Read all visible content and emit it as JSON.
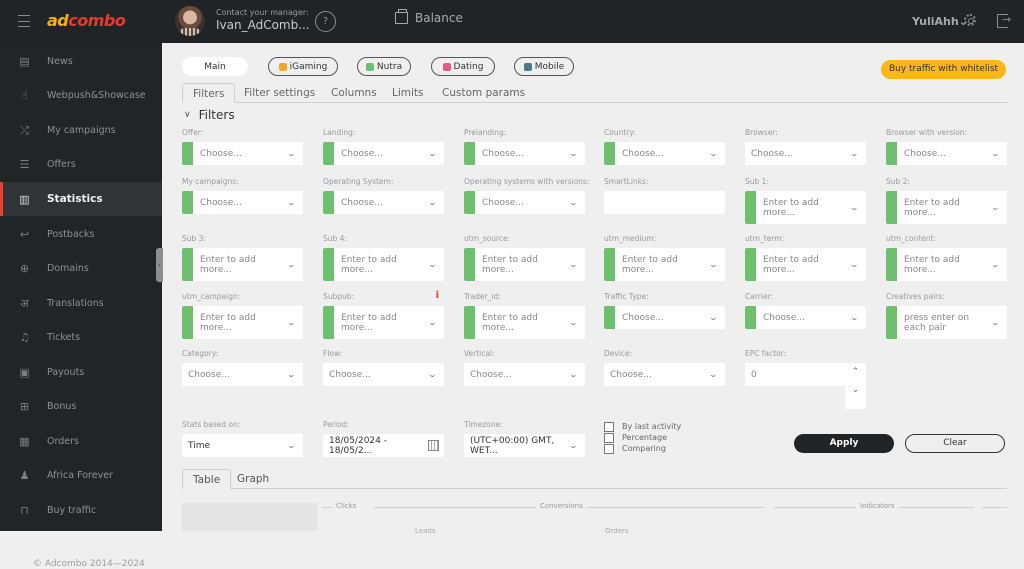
{
  "header": {
    "logo_prefix": "ad",
    "logo_suffix": "combo",
    "manager_label": "Contact your manager:",
    "manager_name": "Ivan_AdComb...",
    "help_glyph": "?",
    "balance_label": "Balance",
    "username": "YuliAhh",
    "username_chevron": "⌄"
  },
  "sidebar": {
    "items": [
      {
        "label": "News",
        "icon": "newspaper-icon",
        "glyph": "▤"
      },
      {
        "label": "Webpush&Showcase",
        "icon": "hand-bell-icon",
        "glyph": "☝"
      },
      {
        "label": "My campaigns",
        "icon": "shuffle-icon",
        "glyph": "⤮"
      },
      {
        "label": "Offers",
        "icon": "document-list-icon",
        "glyph": "☰"
      },
      {
        "label": "Statistics",
        "icon": "bar-chart-icon",
        "glyph": "▥",
        "active": true
      },
      {
        "label": "Postbacks",
        "icon": "return-arrow-icon",
        "glyph": "↩"
      },
      {
        "label": "Domains",
        "icon": "globe-icon",
        "glyph": "⊕"
      },
      {
        "label": "Translations",
        "icon": "translate-icon",
        "glyph": "अ"
      },
      {
        "label": "Tickets",
        "icon": "bell-icon",
        "glyph": "♫"
      },
      {
        "label": "Payouts",
        "icon": "wallet-icon",
        "glyph": "▣"
      },
      {
        "label": "Bonus",
        "icon": "gift-icon",
        "glyph": "⊞"
      },
      {
        "label": "Orders",
        "icon": "calendar-icon",
        "glyph": "▦"
      },
      {
        "label": "Africa Forever",
        "icon": "users-icon",
        "glyph": "♟"
      },
      {
        "label": "Buy traffic",
        "icon": "bag-icon",
        "glyph": "⊓"
      }
    ],
    "copyright": "© Adcombo 2014—2024",
    "collapse_glyph": "‹"
  },
  "verticals": [
    {
      "label": "Main",
      "selected": true
    },
    {
      "label": "iGaming",
      "icon": "slot-icon",
      "color": "#f5a623"
    },
    {
      "label": "Nutra",
      "icon": "leaf-icon",
      "color": "#6ec06f"
    },
    {
      "label": "Dating",
      "icon": "hearts-icon",
      "color": "#e35d8a"
    },
    {
      "label": "Mobile",
      "icon": "phone-icon",
      "color": "#4c7a8a"
    }
  ],
  "buy_whitelist_label": "Buy traffic with whitelist",
  "tabs": [
    {
      "label": "Filters",
      "selected": true
    },
    {
      "label": "Filter settings"
    },
    {
      "label": "Columns"
    },
    {
      "label": "Limits"
    },
    {
      "label": "Custom params"
    }
  ],
  "filters_title": "Filters",
  "filters": [
    {
      "label": "Offer:",
      "value": "Choose..."
    },
    {
      "label": "Landing:",
      "value": "Choose..."
    },
    {
      "label": "Prelanding:",
      "value": "Choose..."
    },
    {
      "label": "Country:",
      "value": "Choose..."
    },
    {
      "label": "Browser:",
      "value": "Choose..."
    },
    {
      "label": "Browser with version:",
      "value": "Choose..."
    },
    {
      "label": "My campaigns:",
      "value": "Choose..."
    },
    {
      "label": "Operating System:",
      "value": "Choose..."
    },
    {
      "label": "Operating systems with versions:",
      "value": "Choose..."
    },
    {
      "label": "SmartLinks:",
      "value": ""
    },
    {
      "label": "Sub 1:",
      "value": "Enter to add more..."
    },
    {
      "label": "Sub 2:",
      "value": "Enter to add more..."
    },
    {
      "label": "Sub 3:",
      "value": "Enter to add more..."
    },
    {
      "label": "Sub 4:",
      "value": "Enter to add more..."
    },
    {
      "label": "utm_source:",
      "value": "Enter to add more..."
    },
    {
      "label": "utm_medium:",
      "value": "Enter to add more..."
    },
    {
      "label": "utm_term:",
      "value": "Enter to add more..."
    },
    {
      "label": "utm_content:",
      "value": "Enter to add more..."
    },
    {
      "label": "utm_campaign:",
      "value": "Enter to add more..."
    },
    {
      "label": "Subpub:",
      "value": "Enter to add more...",
      "info": "i"
    },
    {
      "label": "Trader_id:",
      "value": "Enter to add more..."
    },
    {
      "label": "Traffic Type:",
      "value": "Choose..."
    },
    {
      "label": "Carrier:",
      "value": "Choose..."
    },
    {
      "label": "Creatives pairs:",
      "value": "press enter on each pair"
    },
    {
      "label": "Category:",
      "value": "Choose..."
    },
    {
      "label": "Flow:",
      "value": "Choose..."
    },
    {
      "label": "Vertical:",
      "value": "Choose..."
    },
    {
      "label": "Device:",
      "value": "Choose..."
    },
    {
      "label": "EPC factor:",
      "value": "0"
    }
  ],
  "stats": {
    "based_on_label": "Stats based on:",
    "based_on_value": "Time",
    "period_label": "Period:",
    "period_value": "18/05/2024 - 18/05/2...",
    "timezone_label": "Timezone:",
    "timezone_value": "(UTC+00:00) GMT, WET..."
  },
  "checkboxes": [
    {
      "label": "By last activity",
      "checked": false
    },
    {
      "label": "Percentage",
      "checked": false
    },
    {
      "label": "Comparing",
      "checked": false
    }
  ],
  "apply_label": "Apply",
  "clear_label": "Clear",
  "bottom_tabs": [
    {
      "label": "Table",
      "selected": true
    },
    {
      "label": "Graph"
    }
  ],
  "table_groups": [
    "Clicks",
    "Conversions",
    "Indicators"
  ],
  "table_subheaders": [
    "Leads",
    "Orders"
  ]
}
